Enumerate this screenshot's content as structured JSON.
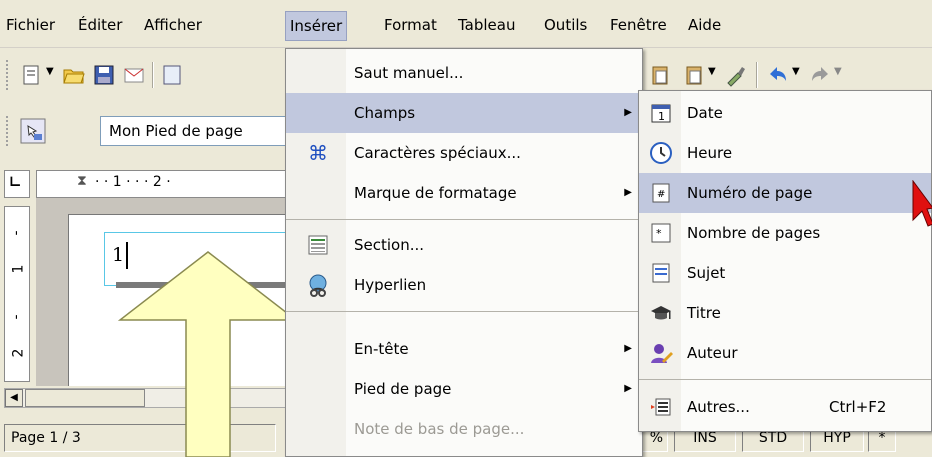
{
  "menubar": {
    "items": [
      "Fichier",
      "Éditer",
      "Afficher",
      "Insérer",
      "Format",
      "Tableau",
      "Outils",
      "Fenêtre",
      "Aide"
    ]
  },
  "toolbar": {
    "style_value": "Mon Pied de page"
  },
  "ruler": {
    "ticks": "· · 1 · · · 2 ·",
    "vticks": [
      "-",
      "1",
      "-",
      "2"
    ]
  },
  "document": {
    "footer_text": "1"
  },
  "statusbar": {
    "page": "Page 1 / 3",
    "pct": "%",
    "ins": "INS",
    "std": "STD",
    "hyp": "HYP",
    "star": "*"
  },
  "insert_menu": {
    "items": [
      {
        "label": "Saut manuel...",
        "icon": "none"
      },
      {
        "label": "Champs",
        "icon": "none",
        "submenu": true
      },
      {
        "label": "Caractères spéciaux...",
        "icon": "special-chars-icon"
      },
      {
        "label": "Marque de formatage",
        "icon": "none",
        "submenu": true
      },
      {
        "label": "Section...",
        "icon": "section-icon"
      },
      {
        "label": "Hyperlien",
        "icon": "hyperlink-icon"
      },
      {
        "label": "En-tête",
        "icon": "none",
        "submenu": true
      },
      {
        "label": "Pied de page",
        "icon": "none",
        "submenu": true
      },
      {
        "label": "Note de bas de page...",
        "icon": "none",
        "disabled": true
      }
    ]
  },
  "fields_menu": {
    "items": [
      {
        "label": "Date",
        "icon": "calendar-icon"
      },
      {
        "label": "Heure",
        "icon": "clock-icon"
      },
      {
        "label": "Numéro de page",
        "icon": "page-number-icon"
      },
      {
        "label": "Nombre de pages",
        "icon": "page-count-icon"
      },
      {
        "label": "Sujet",
        "icon": "subject-icon"
      },
      {
        "label": "Titre",
        "icon": "title-icon"
      },
      {
        "label": "Auteur",
        "icon": "author-icon"
      },
      {
        "label": "Autres...",
        "icon": "other-fields-icon",
        "shortcut": "Ctrl+F2"
      }
    ]
  },
  "colors": {
    "highlight": "#c1c8de",
    "menu_bg": "#fbfbf9",
    "chrome": "#ece9d8",
    "arrow_fill": "#ffffc0",
    "cursor_red": "#e01010"
  }
}
